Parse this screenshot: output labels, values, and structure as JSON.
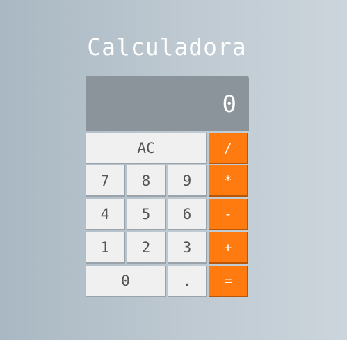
{
  "title": "Calculadora",
  "display": "0",
  "buttons": {
    "ac": "AC",
    "divide": "/",
    "seven": "7",
    "eight": "8",
    "nine": "9",
    "multiply": "*",
    "four": "4",
    "five": "5",
    "six": "6",
    "subtract": "-",
    "one": "1",
    "two": "2",
    "three": "3",
    "add": "+",
    "zero": "0",
    "decimal": ".",
    "equals": "="
  },
  "colors": {
    "operator": "#ff7a0f",
    "display_bg": "#8b949a",
    "key_bg": "#f0f0f0"
  }
}
